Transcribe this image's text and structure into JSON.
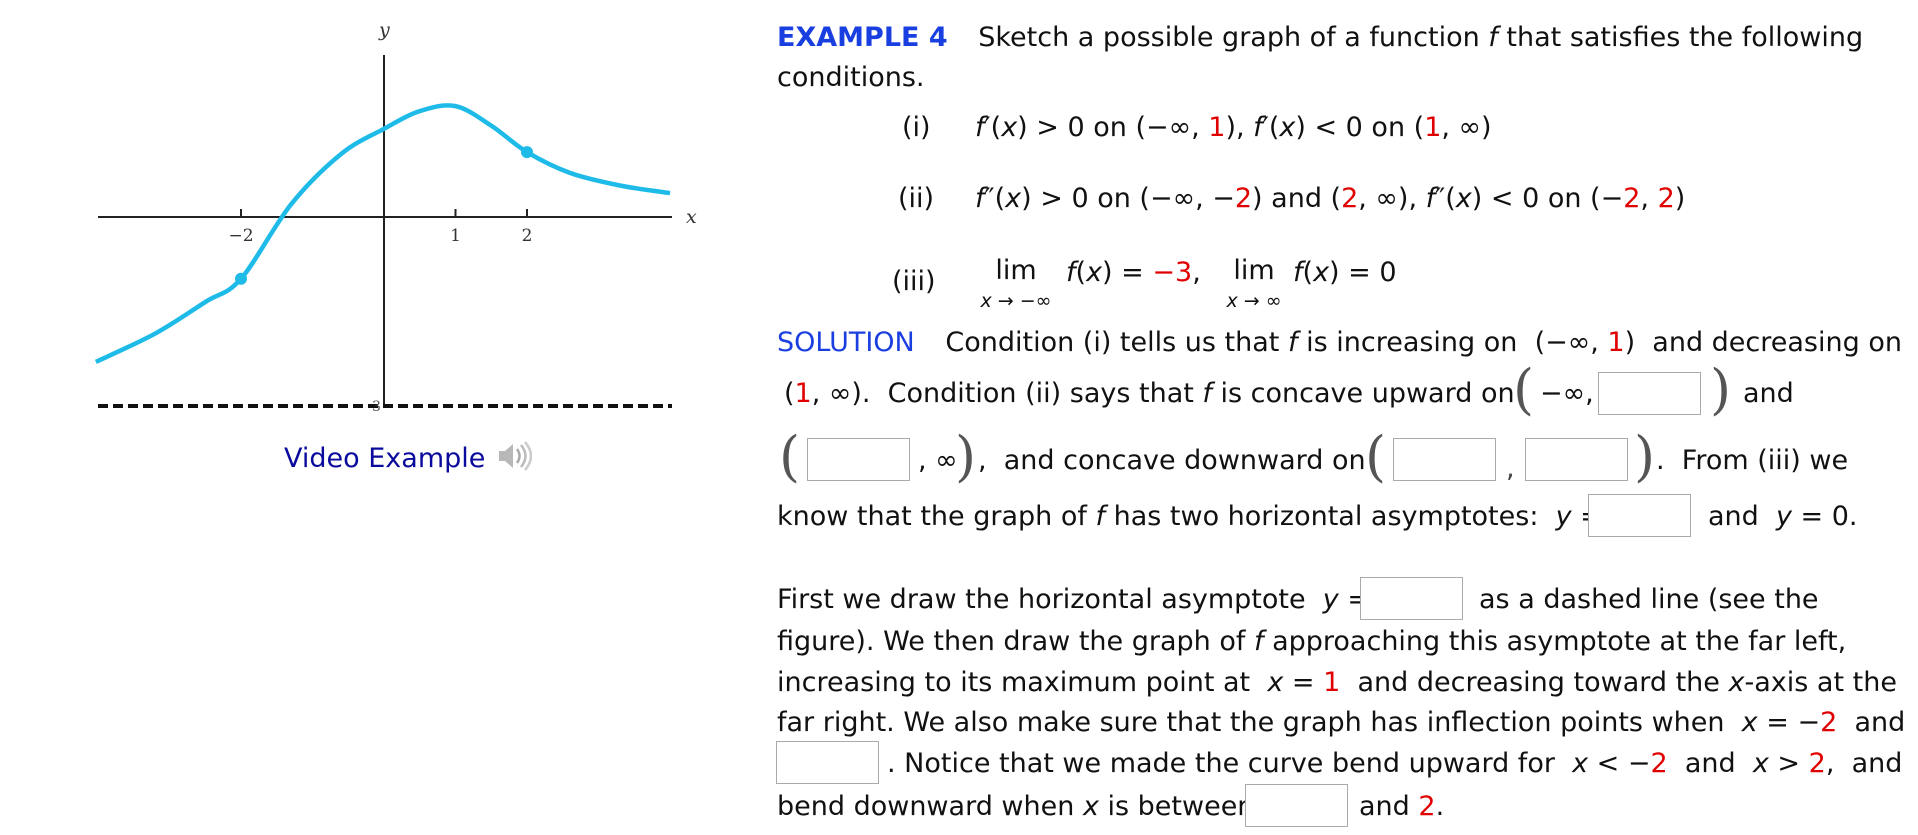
{
  "figure": {
    "x_axis_label": "x",
    "y_axis_label": "y",
    "x_ticks": [
      {
        "value": -2,
        "label": "−2"
      },
      {
        "value": 1,
        "label": "1"
      },
      {
        "value": 2,
        "label": "2"
      }
    ],
    "asymptote_label": "3",
    "asymptote_value": -3,
    "inflection_points_x": [
      -2,
      2
    ],
    "maximum_x": 1,
    "curve_color": "#1ebbe8",
    "video_link": "Video Example",
    "speaker_icon": "speaker-icon"
  },
  "example": {
    "heading": "EXAMPLE 4",
    "prompt_line1": "Sketch a possible graph of a function",
    "prompt_f": "f",
    "prompt_line1_end": "that satisfies the following",
    "prompt_line2": "conditions."
  },
  "conditions": [
    {
      "label": "(i)",
      "text": "f′(x) > 0 on (−∞, 1), f′(x) < 0 on (1, ∞)"
    },
    {
      "label": "(ii)",
      "text": "f″(x) > 0 on (−∞, −2) and (2, ∞), f″(x) < 0 on (−2, 2)"
    },
    {
      "label": "(iii)",
      "lim1_sub": "x → −∞",
      "lim1_val": "−3",
      "lim2_sub": "x → ∞",
      "lim2_val": "0"
    }
  ],
  "solution": {
    "heading": "SOLUTION",
    "line1": "Condition (i) tells us that",
    "line1b": "is increasing on",
    "line1c": "and decreasing on",
    "line2b": "Condition (ii) says that",
    "line2c": "is concave upward on",
    "and": "and",
    "line3b": "and concave downward on",
    "line3c": "From (iii) we",
    "line4a": "know that the graph of",
    "line4b": "has two horizontal asymptotes:",
    "line4c": "and",
    "p2_l1a": "First we draw the horizontal asymptote",
    "p2_l1b": "as a dashed line (see the",
    "p2_l2a": "figure). We then draw the graph of",
    "p2_l2b": "approaching this asymptote at the far left,",
    "p2_l3a": "increasing to its maximum point at",
    "p2_l3b": "and decreasing toward the",
    "p2_l3c": "-axis at the",
    "p2_l4a": "far right. We also make sure that the graph has inflection points when",
    "p2_l4b": "and",
    "p2_l5a": ". Notice that we made the curve bend upward for",
    "p2_l5b": "and",
    "p2_l5c": "and",
    "p2_l6a": "bend downward when",
    "p2_l6b": "is between",
    "p2_l6c": "and",
    "p2_l6d": "2",
    "p2_l6e": "."
  },
  "inputs": {
    "concave_up_right_end": "",
    "concave_up_second_start": "",
    "concave_down_start": "",
    "concave_down_end": "",
    "asymptote_y": "",
    "dashed_asymptote_y": "",
    "second_inflection_x": "",
    "bend_down_lower": ""
  }
}
